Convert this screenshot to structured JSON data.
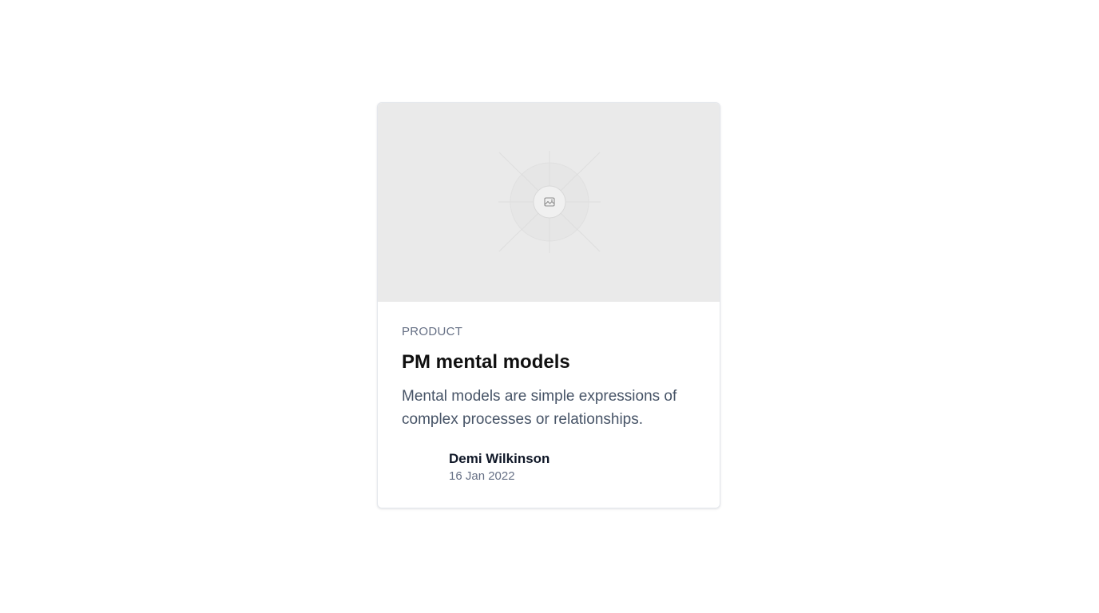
{
  "card": {
    "image": {
      "icon": "image-placeholder-icon",
      "background_color": "#eaeaea"
    },
    "category": "PRODUCT",
    "title": "PM mental models",
    "description": "Mental models are simple expressions of complex processes or relationships.",
    "author": {
      "name": "Demi Wilkinson",
      "date": "16 Jan 2022"
    }
  },
  "colors": {
    "title": "#101010",
    "description": "#475467",
    "muted": "#667085",
    "border": "#e4e7ec"
  }
}
